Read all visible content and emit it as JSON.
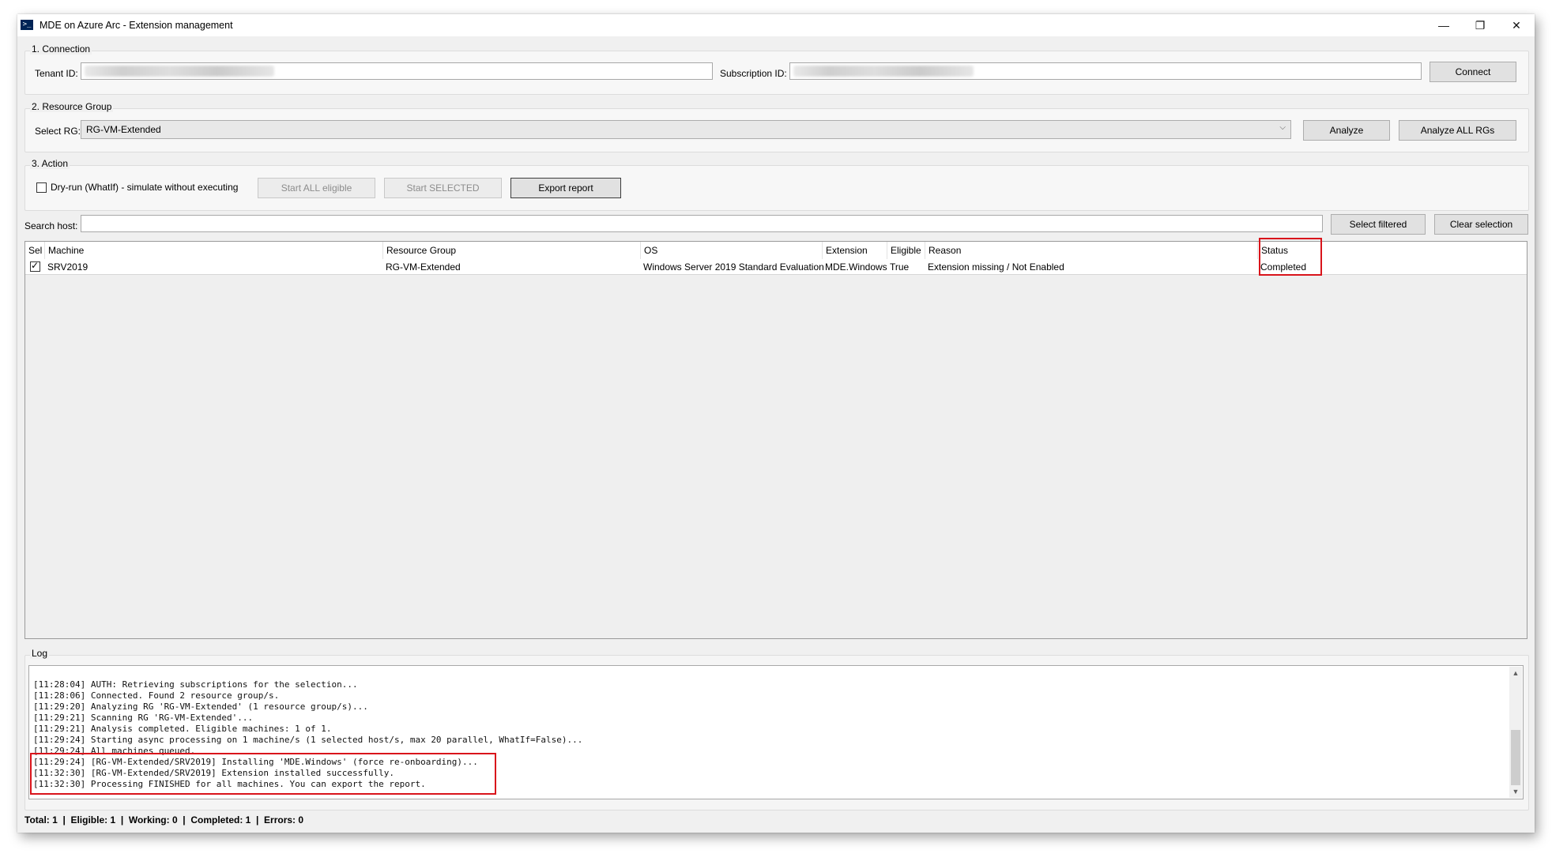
{
  "window": {
    "title": "MDE on Azure Arc - Extension management",
    "app_icon": "powershell-icon",
    "controls": {
      "minimize": "—",
      "restore": "❐",
      "close": "✕"
    }
  },
  "connection": {
    "group_label": "1. Connection",
    "tenant_label": "Tenant ID:",
    "subscription_label": "Subscription ID:",
    "connect_label": "Connect"
  },
  "resource_group": {
    "group_label": "2. Resource Group",
    "select_label": "Select RG:",
    "selected": "RG-VM-Extended",
    "analyze_label": "Analyze",
    "analyze_all_label": "Analyze ALL RGs"
  },
  "action": {
    "group_label": "3. Action",
    "dryrun_label": "Dry-run (WhatIf) - simulate without executing",
    "dryrun_checked": false,
    "start_all_label": "Start ALL eligible",
    "start_selected_label": "Start SELECTED",
    "export_label": "Export report"
  },
  "search": {
    "label": "Search host:",
    "value": "",
    "select_filtered_label": "Select filtered",
    "clear_selection_label": "Clear selection"
  },
  "grid": {
    "columns": [
      "Sel",
      "Machine",
      "Resource Group",
      "OS",
      "Extension",
      "Eligible",
      "Reason",
      "Status"
    ],
    "rows": [
      {
        "sel": true,
        "machine": "SRV2019",
        "resource_group": "RG-VM-Extended",
        "os": "Windows Server 2019 Standard Evaluation",
        "extension": "MDE.Windows",
        "eligible": "True",
        "reason": "Extension missing / Not Enabled",
        "status": "Completed"
      }
    ]
  },
  "log": {
    "label": "Log",
    "lines": [
      "[11:28:04] AUTH: Retrieving subscriptions for the selection...",
      "[11:28:06] Connected. Found 2 resource group/s.",
      "[11:29:20] Analyzing RG 'RG-VM-Extended' (1 resource group/s)...",
      "[11:29:21] Scanning RG 'RG-VM-Extended'...",
      "[11:29:21] Analysis completed. Eligible machines: 1 of 1.",
      "[11:29:24] Starting async processing on 1 machine/s (1 selected host/s, max 20 parallel, WhatIf=False)...",
      "[11:29:24] All machines queued.",
      "[11:29:24] [RG-VM-Extended/SRV2019] Installing 'MDE.Windows' (force re-onboarding)...",
      "[11:32:30] [RG-VM-Extended/SRV2019] Extension installed successfully.",
      "[11:32:30] Processing FINISHED for all machines. You can export the report."
    ]
  },
  "status_bar": {
    "text": "Total: 1  |  Eligible: 1  |  Working: 0  |  Completed: 1  |  Errors: 0"
  },
  "colors": {
    "highlight": "#d9141b",
    "window_bg": "#f0f0f0"
  }
}
